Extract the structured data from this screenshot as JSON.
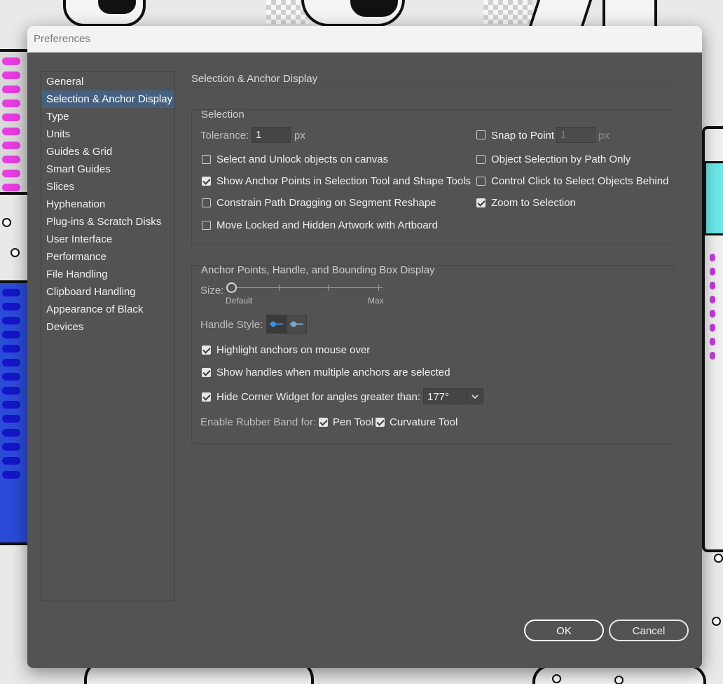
{
  "window": {
    "title": "Preferences"
  },
  "sidebar": {
    "items": [
      {
        "label": "General"
      },
      {
        "label": "Selection & Anchor Display",
        "selected": true
      },
      {
        "label": "Type"
      },
      {
        "label": "Units"
      },
      {
        "label": "Guides & Grid"
      },
      {
        "label": "Smart Guides"
      },
      {
        "label": "Slices"
      },
      {
        "label": "Hyphenation"
      },
      {
        "label": "Plug-ins & Scratch Disks"
      },
      {
        "label": "User Interface"
      },
      {
        "label": "Performance"
      },
      {
        "label": "File Handling"
      },
      {
        "label": "Clipboard Handling"
      },
      {
        "label": "Appearance of Black"
      },
      {
        "label": "Devices"
      }
    ]
  },
  "page": {
    "title": "Selection & Anchor Display"
  },
  "selection": {
    "group_title": "Selection",
    "tolerance_label": "Tolerance:",
    "tolerance_value": "1",
    "tolerance_unit": "px",
    "snap_label": "Snap to Point",
    "snap_value": "1",
    "snap_unit": "px",
    "snap_checked": false,
    "options_left": [
      {
        "label": "Select and Unlock objects on canvas",
        "checked": false
      },
      {
        "label": "Show Anchor Points in Selection Tool and Shape Tools",
        "checked": true
      },
      {
        "label": "Constrain Path Dragging on Segment Reshape",
        "checked": false
      },
      {
        "label": "Move Locked and Hidden Artwork with Artboard",
        "checked": false
      }
    ],
    "options_right": [
      {
        "label": "Object Selection by Path Only",
        "checked": false
      },
      {
        "label": "Control Click to Select Objects Behind",
        "checked": false
      },
      {
        "label": "Zoom to Selection",
        "checked": true
      }
    ]
  },
  "anchor": {
    "group_title": "Anchor Points, Handle, and Bounding Box Display",
    "size_label": "Size:",
    "size_min_label": "Default",
    "size_max_label": "Max",
    "size_level": 0,
    "handle_style_label": "Handle Style:",
    "handle_style_selected": 0,
    "highlight_label": "Highlight anchors on mouse over",
    "highlight_checked": true,
    "show_handles_label": "Show handles when multiple anchors are selected",
    "show_handles_checked": true,
    "hide_corner_label": "Hide Corner Widget for angles greater than:",
    "hide_corner_checked": true,
    "angle_value": "177°",
    "rubber_band_label": "Enable Rubber Band for:",
    "pen_tool_label": "Pen Tool",
    "pen_tool_checked": true,
    "curvature_tool_label": "Curvature Tool",
    "curvature_tool_checked": true
  },
  "buttons": {
    "ok": "OK",
    "cancel": "Cancel"
  },
  "colors": {
    "dialog_bg": "#535353",
    "selected_item": "#46617f",
    "accent_blue": "#3d8fdc"
  }
}
